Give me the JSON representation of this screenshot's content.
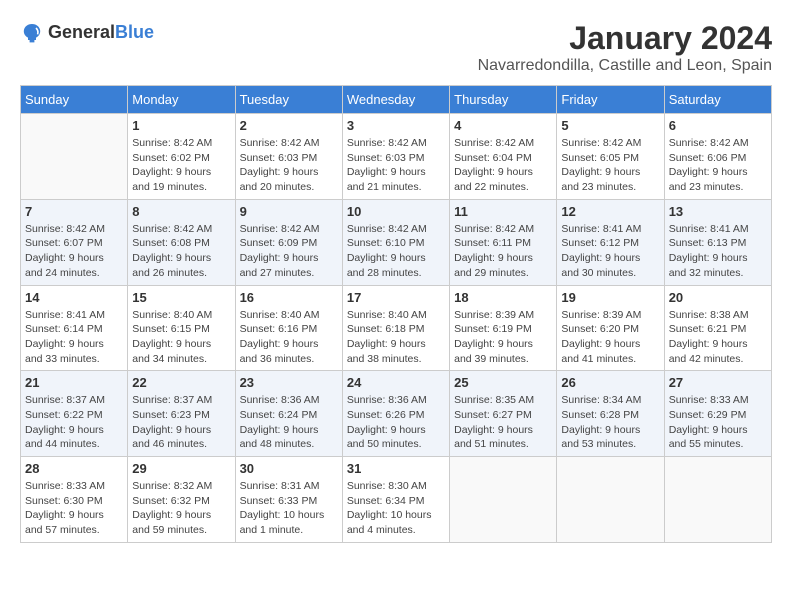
{
  "logo": {
    "general": "General",
    "blue": "Blue"
  },
  "title": "January 2024",
  "location": "Navarredondilla, Castille and Leon, Spain",
  "weekdays": [
    "Sunday",
    "Monday",
    "Tuesday",
    "Wednesday",
    "Thursday",
    "Friday",
    "Saturday"
  ],
  "weeks": [
    [
      {
        "day": "",
        "sunrise": "",
        "sunset": "",
        "daylight": ""
      },
      {
        "day": "1",
        "sunrise": "Sunrise: 8:42 AM",
        "sunset": "Sunset: 6:02 PM",
        "daylight": "Daylight: 9 hours and 19 minutes."
      },
      {
        "day": "2",
        "sunrise": "Sunrise: 8:42 AM",
        "sunset": "Sunset: 6:03 PM",
        "daylight": "Daylight: 9 hours and 20 minutes."
      },
      {
        "day": "3",
        "sunrise": "Sunrise: 8:42 AM",
        "sunset": "Sunset: 6:03 PM",
        "daylight": "Daylight: 9 hours and 21 minutes."
      },
      {
        "day": "4",
        "sunrise": "Sunrise: 8:42 AM",
        "sunset": "Sunset: 6:04 PM",
        "daylight": "Daylight: 9 hours and 22 minutes."
      },
      {
        "day": "5",
        "sunrise": "Sunrise: 8:42 AM",
        "sunset": "Sunset: 6:05 PM",
        "daylight": "Daylight: 9 hours and 23 minutes."
      },
      {
        "day": "6",
        "sunrise": "Sunrise: 8:42 AM",
        "sunset": "Sunset: 6:06 PM",
        "daylight": "Daylight: 9 hours and 23 minutes."
      }
    ],
    [
      {
        "day": "7",
        "sunrise": "",
        "sunset": "",
        "daylight": ""
      },
      {
        "day": "8",
        "sunrise": "Sunrise: 8:42 AM",
        "sunset": "Sunset: 6:08 PM",
        "daylight": "Daylight: 9 hours and 26 minutes."
      },
      {
        "day": "9",
        "sunrise": "Sunrise: 8:42 AM",
        "sunset": "Sunset: 6:09 PM",
        "daylight": "Daylight: 9 hours and 27 minutes."
      },
      {
        "day": "10",
        "sunrise": "Sunrise: 8:42 AM",
        "sunset": "Sunset: 6:10 PM",
        "daylight": "Daylight: 9 hours and 28 minutes."
      },
      {
        "day": "11",
        "sunrise": "Sunrise: 8:42 AM",
        "sunset": "Sunset: 6:11 PM",
        "daylight": "Daylight: 9 hours and 29 minutes."
      },
      {
        "day": "12",
        "sunrise": "Sunrise: 8:41 AM",
        "sunset": "Sunset: 6:12 PM",
        "daylight": "Daylight: 9 hours and 30 minutes."
      },
      {
        "day": "13",
        "sunrise": "Sunrise: 8:41 AM",
        "sunset": "Sunset: 6:13 PM",
        "daylight": "Daylight: 9 hours and 32 minutes."
      }
    ],
    [
      {
        "day": "14",
        "sunrise": "",
        "sunset": "",
        "daylight": ""
      },
      {
        "day": "15",
        "sunrise": "Sunrise: 8:40 AM",
        "sunset": "Sunset: 6:15 PM",
        "daylight": "Daylight: 9 hours and 34 minutes."
      },
      {
        "day": "16",
        "sunrise": "Sunrise: 8:40 AM",
        "sunset": "Sunset: 6:16 PM",
        "daylight": "Daylight: 9 hours and 36 minutes."
      },
      {
        "day": "17",
        "sunrise": "Sunrise: 8:40 AM",
        "sunset": "Sunset: 6:18 PM",
        "daylight": "Daylight: 9 hours and 38 minutes."
      },
      {
        "day": "18",
        "sunrise": "Sunrise: 8:39 AM",
        "sunset": "Sunset: 6:19 PM",
        "daylight": "Daylight: 9 hours and 39 minutes."
      },
      {
        "day": "19",
        "sunrise": "Sunrise: 8:39 AM",
        "sunset": "Sunset: 6:20 PM",
        "daylight": "Daylight: 9 hours and 41 minutes."
      },
      {
        "day": "20",
        "sunrise": "Sunrise: 8:38 AM",
        "sunset": "Sunset: 6:21 PM",
        "daylight": "Daylight: 9 hours and 42 minutes."
      }
    ],
    [
      {
        "day": "21",
        "sunrise": "",
        "sunset": "",
        "daylight": ""
      },
      {
        "day": "22",
        "sunrise": "Sunrise: 8:37 AM",
        "sunset": "Sunset: 6:23 PM",
        "daylight": "Daylight: 9 hours and 46 minutes."
      },
      {
        "day": "23",
        "sunrise": "Sunrise: 8:36 AM",
        "sunset": "Sunset: 6:24 PM",
        "daylight": "Daylight: 9 hours and 48 minutes."
      },
      {
        "day": "24",
        "sunrise": "Sunrise: 8:36 AM",
        "sunset": "Sunset: 6:26 PM",
        "daylight": "Daylight: 9 hours and 50 minutes."
      },
      {
        "day": "25",
        "sunrise": "Sunrise: 8:35 AM",
        "sunset": "Sunset: 6:27 PM",
        "daylight": "Daylight: 9 hours and 51 minutes."
      },
      {
        "day": "26",
        "sunrise": "Sunrise: 8:34 AM",
        "sunset": "Sunset: 6:28 PM",
        "daylight": "Daylight: 9 hours and 53 minutes."
      },
      {
        "day": "27",
        "sunrise": "Sunrise: 8:33 AM",
        "sunset": "Sunset: 6:29 PM",
        "daylight": "Daylight: 9 hours and 55 minutes."
      }
    ],
    [
      {
        "day": "28",
        "sunrise": "",
        "sunset": "",
        "daylight": ""
      },
      {
        "day": "29",
        "sunrise": "Sunrise: 8:32 AM",
        "sunset": "Sunset: 6:32 PM",
        "daylight": "Daylight: 9 hours and 59 minutes."
      },
      {
        "day": "30",
        "sunrise": "Sunrise: 8:31 AM",
        "sunset": "Sunset: 6:33 PM",
        "daylight": "Daylight: 10 hours and 1 minute."
      },
      {
        "day": "31",
        "sunrise": "Sunrise: 8:30 AM",
        "sunset": "Sunset: 6:34 PM",
        "daylight": "Daylight: 10 hours and 4 minutes."
      },
      {
        "day": "",
        "sunrise": "",
        "sunset": "",
        "daylight": ""
      },
      {
        "day": "",
        "sunrise": "",
        "sunset": "",
        "daylight": ""
      },
      {
        "day": "",
        "sunrise": "",
        "sunset": "",
        "daylight": ""
      }
    ]
  ],
  "week0_sunday": {
    "sunrise": "Sunrise: 8:42 AM",
    "sunset": "Sunset: 6:07 PM",
    "daylight": "Daylight: 9 hours and 24 minutes."
  },
  "week1_sunday": {
    "sunrise": "Sunrise: 8:41 AM",
    "sunset": "Sunset: 6:14 PM",
    "daylight": "Daylight: 9 hours and 33 minutes."
  },
  "week2_sunday": {
    "sunrise": "Sunrise: 8:37 AM",
    "sunset": "Sunset: 6:22 PM",
    "daylight": "Daylight: 9 hours and 44 minutes."
  },
  "week3_sunday": {
    "sunrise": "Sunrise: 8:33 AM",
    "sunset": "Sunset: 6:30 PM",
    "daylight": "Daylight: 9 hours and 57 minutes."
  }
}
